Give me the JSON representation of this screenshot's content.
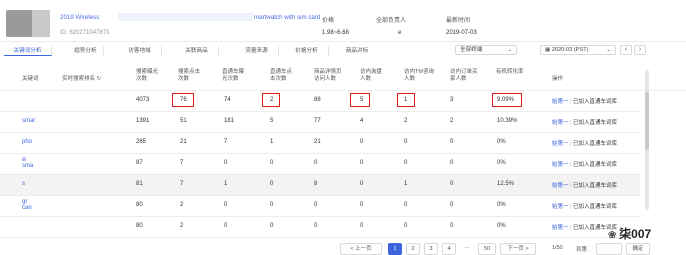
{
  "product": {
    "title_start": "2019 Wireless",
    "title_end": "martwatch with sim card",
    "id": "ID: 620271047873"
  },
  "info": {
    "price_label": "价格",
    "price_value": "1.98~6.68",
    "owner_label": "全部负责人",
    "owner_value": "e",
    "updated_label": "最新时间",
    "updated_value": "2019-07-03"
  },
  "tabs": [
    "关键词分析",
    "趋势分析",
    "访客地域",
    "关联商品",
    "流量来源",
    "价格分析",
    "商品对标"
  ],
  "filters": {
    "terminal": "全部终端",
    "date": "2020-03 (PST)"
  },
  "columns": {
    "keyword": "关键词",
    "realtime_rank": "实时搜索排名",
    "search_exposure": "搜索曝光次数",
    "search_clicks": "搜索点击次数",
    "direct_exposure": "直通车曝光次数",
    "direct_clicks": "直通车点击次数",
    "detail_visitors": "商品详情页访问人数",
    "inquiry_people": "访内询盘人数",
    "tm_people": "访内TM咨询人数",
    "order_people": "访内订单买家人数",
    "order_rate": "有机转化率",
    "action": "操作"
  },
  "rows": [
    {
      "kw": "",
      "exp": "4073",
      "clk": "76",
      "dexp": "74",
      "dclk": "2",
      "det": "88",
      "inq": "5",
      "tm": "1",
      "ord": "3",
      "rate": "9.09%",
      "op_link": "始第一",
      "op_text": "已加入直通车词库"
    },
    {
      "kw": "smar",
      "exp": "1391",
      "clk": "51",
      "dexp": "181",
      "dclk": "5",
      "det": "77",
      "inq": "4",
      "tm": "2",
      "ord": "2",
      "rate": "10.39%",
      "op_link": "始第一",
      "op_text": "已加入直通车词库"
    },
    {
      "kw": "pho",
      "exp": "265",
      "clk": "21",
      "dexp": "7",
      "dclk": "1",
      "det": "21",
      "inq": "0",
      "tm": "0",
      "ord": "0",
      "rate": "0%",
      "op_link": "始第一",
      "op_text": "已加入直通车词库"
    },
    {
      "kw": "w\nsma",
      "exp": "87",
      "clk": "7",
      "dexp": "0",
      "dclk": "0",
      "det": "0",
      "inq": "0",
      "tm": "0",
      "ord": "0",
      "rate": "0%",
      "op_link": "始第一",
      "op_text": "已加入直通车词库"
    },
    {
      "kw": "s",
      "exp": "81",
      "clk": "7",
      "dexp": "1",
      "dclk": "0",
      "det": "8",
      "inq": "0",
      "tm": "1",
      "ord": "0",
      "rate": "12.5%",
      "op_link": "始第一",
      "op_text": "已加入直通车词库"
    },
    {
      "kw": "gr\ncan",
      "exp": "80",
      "clk": "2",
      "dexp": "0",
      "dclk": "0",
      "det": "0",
      "inq": "0",
      "tm": "0",
      "ord": "0",
      "rate": "0%",
      "op_link": "始第一",
      "op_text": "已加入直通车词库"
    },
    {
      "kw": "",
      "exp": "80",
      "clk": "2",
      "dexp": "0",
      "dclk": "0",
      "det": "0",
      "inq": "0",
      "tm": "0",
      "ord": "0",
      "rate": "0%",
      "op_link": "始第一",
      "op_text": "已加入直通车词库"
    }
  ],
  "pagination": {
    "prev": "< 上一页",
    "pages": [
      "1",
      "2",
      "3",
      "4"
    ],
    "ellipsis": "···",
    "last": "50",
    "next": "下一页 >",
    "total": "1/50",
    "goto_label": "到第",
    "confirm": "确定"
  },
  "watermark": "柒007",
  "colors": {
    "accent": "#3d63dd",
    "highlight": "#e11d1d"
  }
}
